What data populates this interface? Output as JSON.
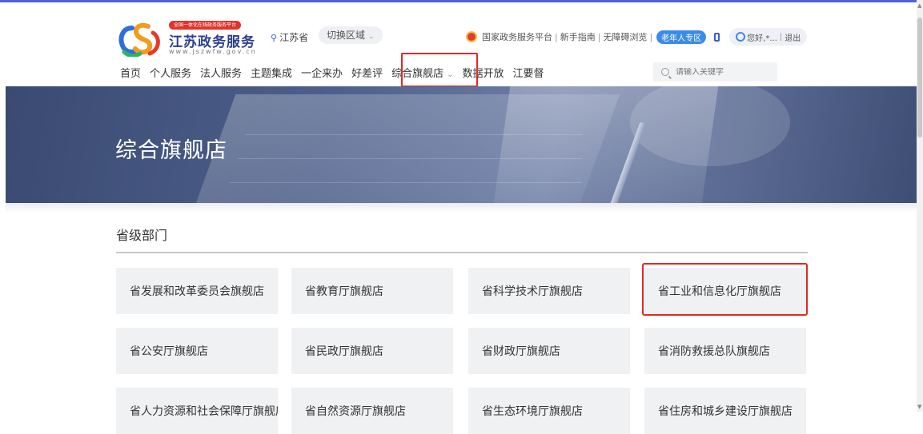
{
  "logo": {
    "slogan": "全国一体化在线政务服务平台",
    "title": "江苏政务服务",
    "url": "www.jszwfw.gov.cn"
  },
  "region": {
    "current": "江苏省",
    "switch_label": "切换区域"
  },
  "top_links": {
    "national_platform": "国家政务服务平台",
    "guide": "新手指南",
    "accessible": "无障碍浏览",
    "elder": "老年人专区",
    "greeting": "您好,*...",
    "logout": "退出",
    "separator": "|"
  },
  "nav": {
    "items": [
      "首页",
      "个人服务",
      "法人服务",
      "主题集成",
      "一企来办",
      "好差评",
      "综合旗舰店",
      "数据开放",
      "江要督"
    ],
    "active_index": 6
  },
  "search": {
    "placeholder": "请输入关键字"
  },
  "banner": {
    "title": "综合旗舰店"
  },
  "section": {
    "title": "省级部门"
  },
  "departments": [
    "省发展和改革委员会旗舰店",
    "省教育厅旗舰店",
    "省科学技术厅旗舰店",
    "省工业和信息化厅旗舰店",
    "省公安厅旗舰店",
    "省民政厅旗舰店",
    "省财政厅旗舰店",
    "省消防救援总队旗舰店",
    "省人力资源和社会保障厅旗舰店",
    "省自然资源厅旗舰店",
    "省生态环境厅旗舰店",
    "省住房和城乡建设厅旗舰店"
  ],
  "colors": {
    "accent": "#4f63d8",
    "highlight": "#e02a20",
    "brand_red": "#e2322c",
    "brand_blue": "#2b3f8f",
    "card_bg": "#f0f1f3"
  },
  "icons": [
    "pin-icon",
    "chevron-down-icon",
    "national-emblem-icon",
    "phone-icon",
    "user-icon",
    "search-icon"
  ]
}
